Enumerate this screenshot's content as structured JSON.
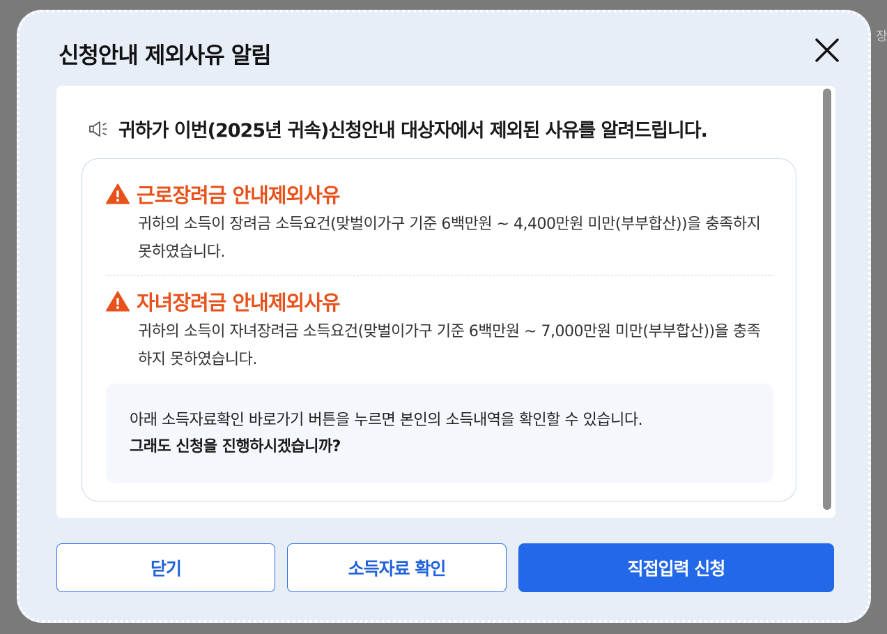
{
  "background": {
    "partial_text": "장"
  },
  "modal": {
    "title": "신청안내 제외사유 알림",
    "intro_text": "귀하가 이번(2025년 귀속)신청안내 대상자에서 제외된 사유를 알려드립니다.",
    "reasons": [
      {
        "title": "근로장려금 안내제외사유",
        "description": "귀하의 소득이 장려금 소득요건(맞벌이가구 기준 6백만원 ~ 4,400만원 미만(부부합산))을 충족하지 못하였습니다."
      },
      {
        "title": "자녀장려금 안내제외사유",
        "description": "귀하의 소득이 자녀장려금 소득요건(맞벌이가구 기준 6백만원 ~ 7,000만원 미만(부부합산))을 충족하지 못하였습니다."
      }
    ],
    "notice": {
      "line1": "아래 소득자료확인 바로가기 버튼을 누르면 본인의 소득내역을 확인할 수 있습니다.",
      "line2": "그래도 신청을 진행하시겠습니까?"
    },
    "buttons": {
      "close_label": "닫기",
      "income_check_label": "소득자료 확인",
      "direct_apply_label": "직접입력 신청"
    }
  },
  "colors": {
    "modal_bg": "#e8eef8",
    "warning": "#e8511b",
    "primary": "#2368e8",
    "outline_text": "#2062d9"
  },
  "icons": {
    "close": "close-icon",
    "intro": "megaphone-icon",
    "reason": "warning-triangle-icon"
  }
}
